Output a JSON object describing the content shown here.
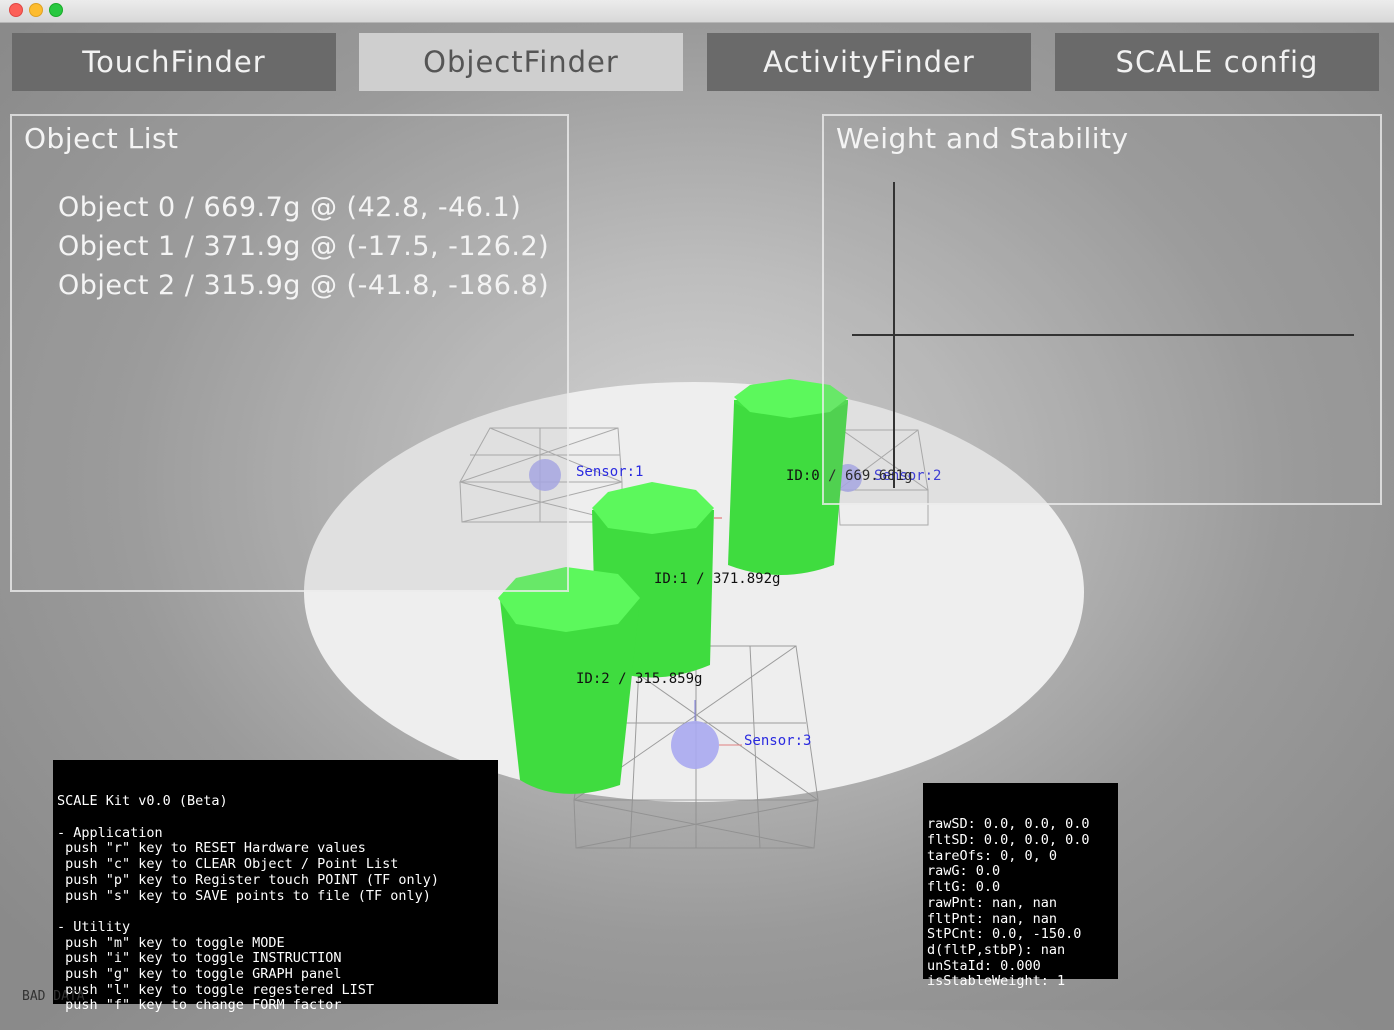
{
  "tabs": [
    {
      "label": "TouchFinder",
      "active": false
    },
    {
      "label": "ObjectFinder",
      "active": true
    },
    {
      "label": "ActivityFinder",
      "active": false
    },
    {
      "label": "SCALE config",
      "active": false
    }
  ],
  "object_list": {
    "title": "Object List",
    "items": [
      "Object 0 / 669.7g @ (42.8, -46.1)",
      "Object 1 / 371.9g @ (-17.5, -126.2)",
      "Object 2 / 315.9g @ (-41.8, -186.8)"
    ]
  },
  "weight_panel": {
    "title": "Weight and Stability"
  },
  "scene": {
    "sensors": [
      "Sensor:1",
      "Sensor:2",
      "Sensor:3"
    ],
    "objects": [
      "ID:0 / 669.681g",
      "ID:1 / 371.892g",
      "ID:2 / 315.859g"
    ],
    "colors": {
      "object": "#4ef24e",
      "sensor": "#a8a8f0",
      "sensor_label": "#2a2ae0",
      "plate": "#eeeeee"
    }
  },
  "instructions": {
    "lines": [
      "SCALE Kit v0.0 (Beta)",
      "",
      "- Application",
      " push \"r\" key to RESET Hardware values",
      " push \"c\" key to CLEAR Object / Point List",
      " push \"p\" key to Register touch POINT (TF only)",
      " push \"s\" key to SAVE points to file (TF only)",
      "",
      "- Utility",
      " push \"m\" key to toggle MODE",
      " push \"i\" key to toggle INSTRUCTION",
      " push \"g\" key to toggle GRAPH panel",
      " push \"l\" key to toggle regestered LIST",
      " push \"f\" key to change FORM factor"
    ]
  },
  "debug": {
    "lines": [
      "rawSD: 0.0, 0.0, 0.0",
      "fltSD: 0.0, 0.0, 0.0",
      "tareOfs: 0, 0, 0",
      "rawG: 0.0",
      "fltG: 0.0",
      "rawPnt: nan, nan",
      "fltPnt: nan, nan",
      "StPCnt: 0.0, -150.0",
      "d(fltP,stbP): nan",
      "unStaId: 0.000",
      "isStableWeight: 1"
    ]
  },
  "status_text": "BAD DATA"
}
